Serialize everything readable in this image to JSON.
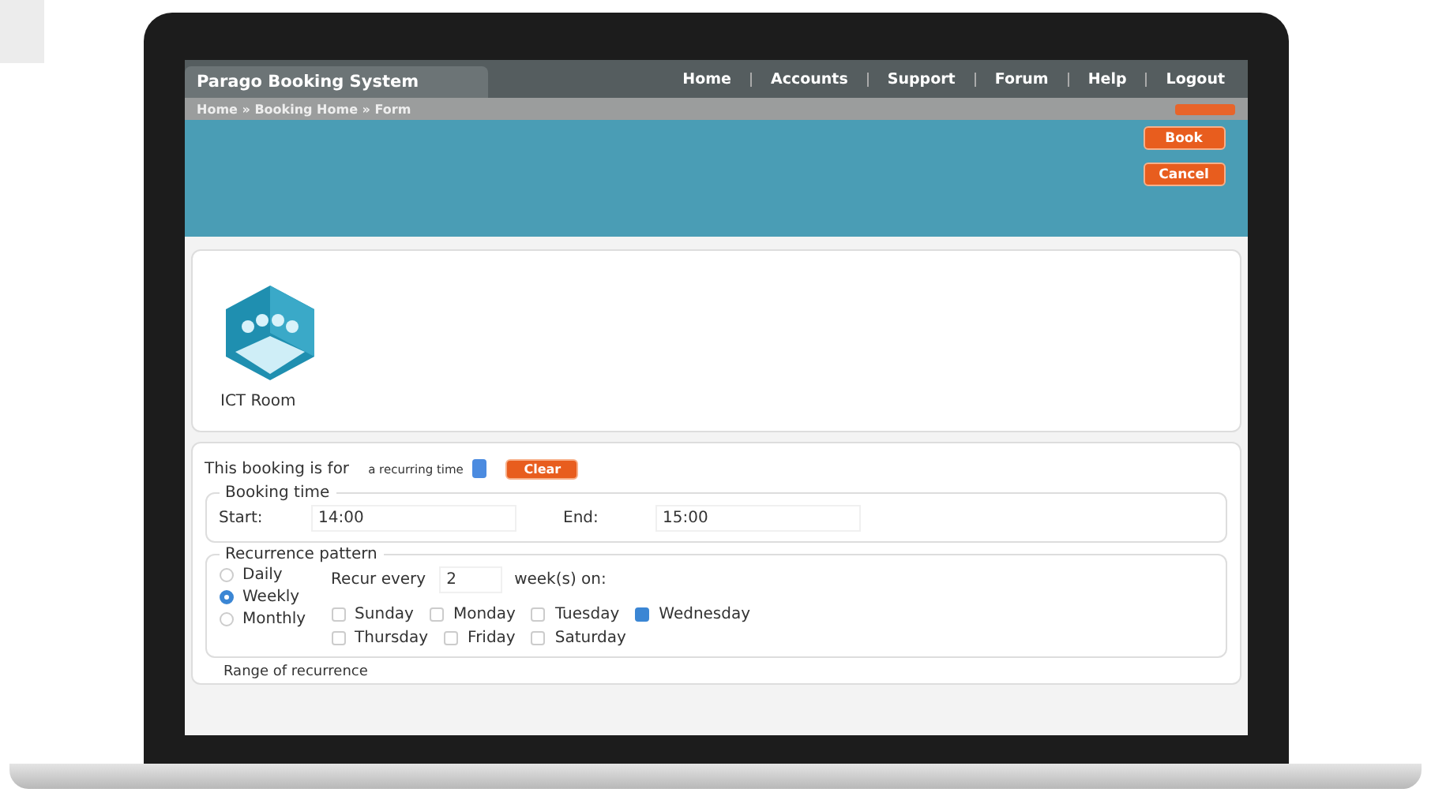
{
  "app": {
    "title": "Parago Booking System"
  },
  "nav": [
    {
      "label": "Home"
    },
    {
      "label": "Accounts"
    },
    {
      "label": "Support"
    },
    {
      "label": "Forum"
    },
    {
      "label": "Help"
    },
    {
      "label": "Logout"
    }
  ],
  "breadcrumb": "Home » Booking Home » Form",
  "actions": [
    {
      "label": "Book"
    },
    {
      "label": "Cancel"
    }
  ],
  "room": {
    "name": "ICT Room"
  },
  "booking_for": {
    "label": "This booking is for",
    "value": "a recurring time",
    "clear": "Clear"
  },
  "booking_time": {
    "legend": "Booking time",
    "start_label": "Start:",
    "start": "14:00",
    "end_label": "End:",
    "end": "15:00"
  },
  "recurrence": {
    "legend": "Recurrence pattern",
    "patterns": [
      {
        "label": "Daily",
        "selected": false
      },
      {
        "label": "Weekly",
        "selected": true
      },
      {
        "label": "Monthly",
        "selected": false
      }
    ],
    "recur_label": "Recur every",
    "recur_value": "2",
    "recur_suffix": "week(s) on:",
    "days": [
      {
        "label": "Sunday",
        "checked": false
      },
      {
        "label": "Monday",
        "checked": false
      },
      {
        "label": "Tuesday",
        "checked": false
      },
      {
        "label": "Wednesday",
        "checked": true
      },
      {
        "label": "Thursday",
        "checked": false
      },
      {
        "label": "Friday",
        "checked": false
      },
      {
        "label": "Saturday",
        "checked": false
      }
    ]
  },
  "range": {
    "legend": "Range of recurrence"
  }
}
